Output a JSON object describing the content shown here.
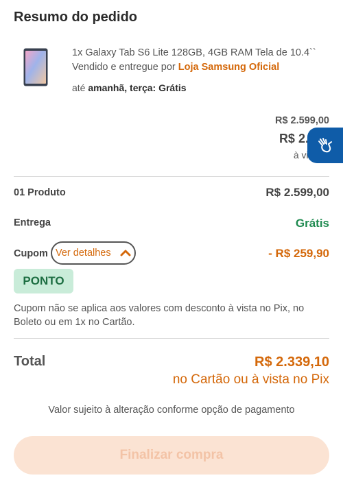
{
  "header": {
    "title": "Resumo do pedido"
  },
  "product": {
    "description": "1x Galaxy Tab S6 Lite 128GB, 4GB RAM Tela de 10.4``",
    "sold_by_prefix": "Vendido e entregue por ",
    "seller": "Loja Samsung Oficial",
    "delivery_prefix": "até ",
    "delivery_day": "amanhã, terça:",
    "delivery_price": "Grátis"
  },
  "pricing": {
    "original_price": "R$ 2.599,00",
    "current_price": "R$ 2.339",
    "current_note": "à vista n"
  },
  "summary": {
    "products_label": "01 Produto",
    "products_value": "R$ 2.599,00",
    "shipping_label": "Entrega",
    "shipping_value": "Grátis",
    "coupon_label": "Cupom",
    "coupon_details_button": "Ver detalhes",
    "coupon_value": "- R$ 259,90",
    "coupon_code": "PONTO",
    "coupon_note": "Cupom não se aplica aos valores com desconto à vista no Pix, no Boleto ou em 1x no Cartão."
  },
  "total": {
    "label": "Total",
    "value": "R$ 2.339,10",
    "method": "no Cartão ou à vista no Pix"
  },
  "disclaimer": "Valor sujeito à alteração conforme opção de pagamento",
  "actions": {
    "finalize_label": "Finalizar compra"
  },
  "icons": {
    "accessibility": "hand-sign-language-icon",
    "chevron": "chevron-up-icon"
  },
  "colors": {
    "accent_orange": "#d4680a",
    "success_green": "#1e8a4f",
    "accessibility_blue": "#0f5ca8",
    "disabled_button_bg": "#fbe3d3"
  }
}
